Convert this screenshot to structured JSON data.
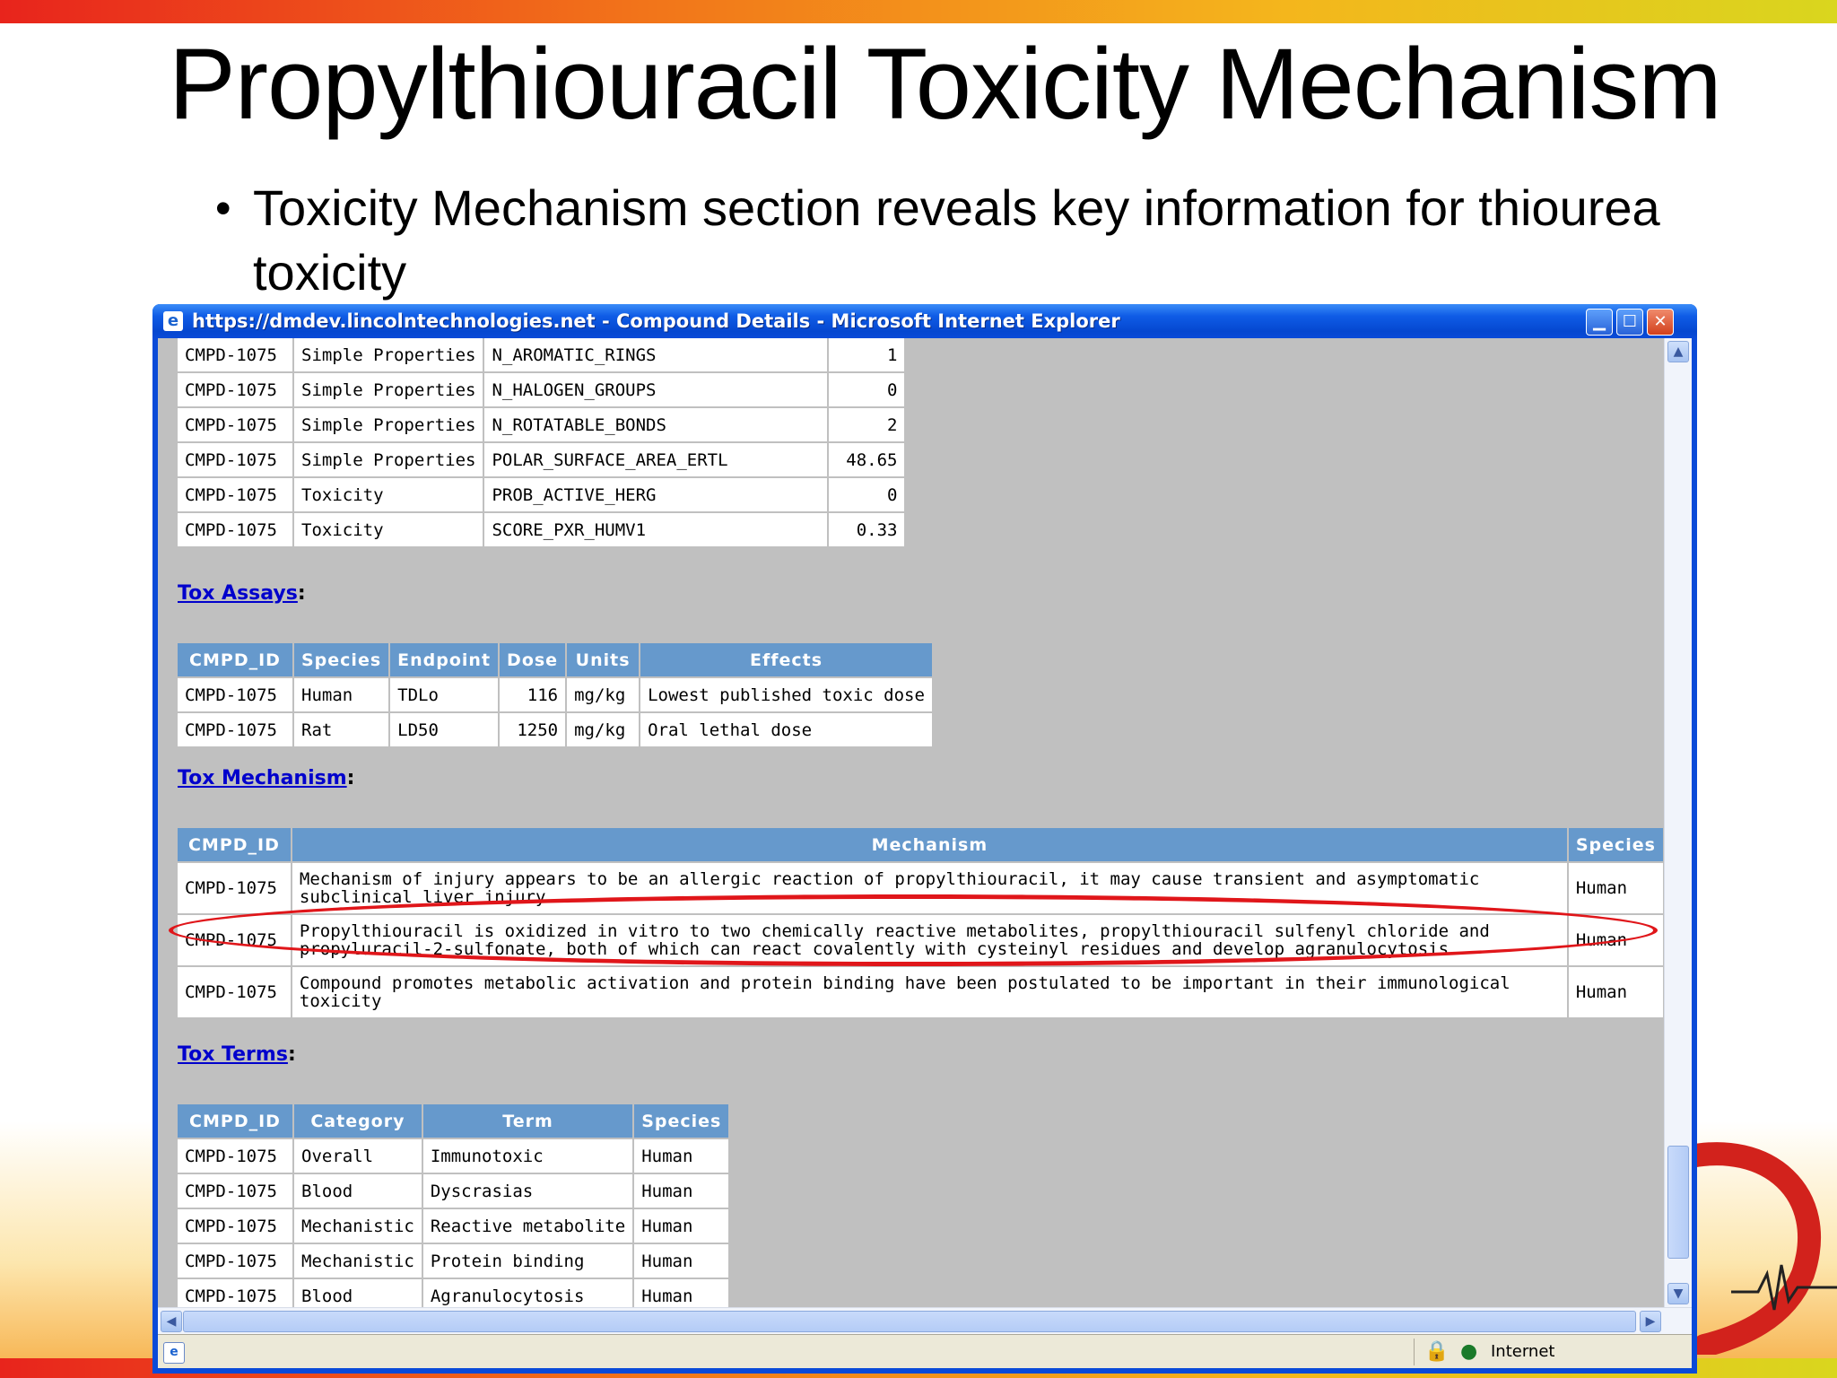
{
  "slide": {
    "title": "Propylthiouracil Toxicity Mechanism",
    "bullet_marker": "•",
    "bullet": "Toxicity Mechanism section reveals key information for thiourea toxicity"
  },
  "window": {
    "title": "https://dmdev.lincolntechnologies.net - Compound Details - Microsoft Internet Explorer",
    "app_icon": "ie-page-icon",
    "minimize_glyph": "▁",
    "maximize_glyph": "☐",
    "close_glyph": "✕"
  },
  "properties_table": {
    "rows": [
      [
        "CMPD-1075",
        "Simple Properties",
        "N_AROMATIC_RINGS",
        "1"
      ],
      [
        "CMPD-1075",
        "Simple Properties",
        "N_HALOGEN_GROUPS",
        "0"
      ],
      [
        "CMPD-1075",
        "Simple Properties",
        "N_ROTATABLE_BONDS",
        "2"
      ],
      [
        "CMPD-1075",
        "Simple Properties",
        "POLAR_SURFACE_AREA_ERTL",
        "48.65"
      ],
      [
        "CMPD-1075",
        "Toxicity",
        "PROB_ACTIVE_HERG",
        "0"
      ],
      [
        "CMPD-1075",
        "Toxicity",
        "SCORE_PXR_HUMV1",
        "0.33"
      ]
    ]
  },
  "tox_assays": {
    "link": "Tox Assays",
    "colon": ":",
    "headers": [
      "CMPD_ID",
      "Species",
      "Endpoint",
      "Dose",
      "Units",
      "Effects"
    ],
    "rows": [
      [
        "CMPD-1075",
        "Human",
        "TDLo",
        "116",
        "mg/kg",
        "Lowest published toxic dose"
      ],
      [
        "CMPD-1075",
        "Rat",
        "LD50",
        "1250",
        "mg/kg",
        "Oral lethal dose"
      ]
    ]
  },
  "tox_mechanism": {
    "link": "Tox Mechanism",
    "colon": ":",
    "headers": [
      "CMPD_ID",
      "Mechanism",
      "Species"
    ],
    "rows": [
      [
        "CMPD-1075",
        "Mechanism of injury appears to be an allergic reaction of propylthiouracil, it may cause transient and asymptomatic subclinical liver injury",
        "Human"
      ],
      [
        "CMPD-1075",
        "Propylthiouracil is oxidized in vitro to two chemically reactive metabolites, propylthiouracil sulfenyl chloride and propyluracil-2-sulfonate, both of which can react covalently with cysteinyl residues and develop agranulocytosis",
        "Human"
      ],
      [
        "CMPD-1075",
        "Compound promotes metabolic activation and protein binding have been postulated to be important in their immunological toxicity",
        "Human"
      ]
    ]
  },
  "tox_terms": {
    "link": "Tox Terms",
    "colon": ":",
    "headers": [
      "CMPD_ID",
      "Category",
      "Term",
      "Species"
    ],
    "rows": [
      [
        "CMPD-1075",
        "Overall",
        "Immunotoxic",
        "Human"
      ],
      [
        "CMPD-1075",
        "Blood",
        "Dyscrasias",
        "Human"
      ],
      [
        "CMPD-1075",
        "Mechanistic",
        "Reactive metabolite",
        "Human"
      ],
      [
        "CMPD-1075",
        "Mechanistic",
        "Protein binding",
        "Human"
      ],
      [
        "CMPD-1075",
        "Blood",
        "Agranulocytosis",
        "Human"
      ]
    ]
  },
  "scrollbars": {
    "up_glyph": "▲",
    "down_glyph": "▼",
    "left_glyph": "◀",
    "right_glyph": "▶"
  },
  "statusbar": {
    "zone": "Internet",
    "lock_icon": "lock-icon",
    "zone_icon": "globe-icon"
  },
  "colors": {
    "table_header": "#6699cc",
    "highlight_ellipse": "#e0161a",
    "link": "#0000cc",
    "page_background": "#c0c0c0"
  }
}
